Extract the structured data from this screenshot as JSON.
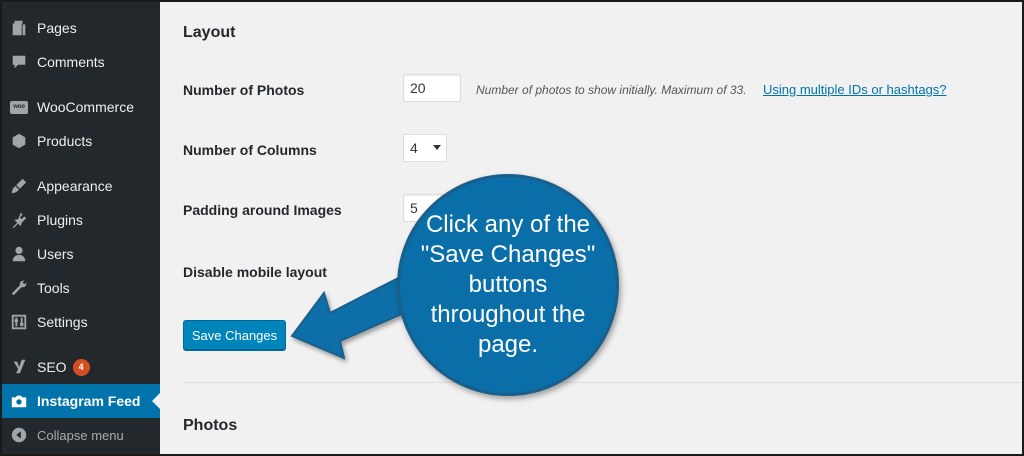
{
  "sidebar": {
    "items": [
      {
        "label": "Pages",
        "icon": "pages-icon"
      },
      {
        "label": "Comments",
        "icon": "comments-icon"
      },
      {
        "label": "WooCommerce",
        "icon": "woocommerce-icon",
        "icon_text": "woo"
      },
      {
        "label": "Products",
        "icon": "products-icon"
      },
      {
        "label": "Appearance",
        "icon": "appearance-icon"
      },
      {
        "label": "Plugins",
        "icon": "plugins-icon"
      },
      {
        "label": "Users",
        "icon": "users-icon"
      },
      {
        "label": "Tools",
        "icon": "tools-icon"
      },
      {
        "label": "Settings",
        "icon": "settings-icon"
      },
      {
        "label": "SEO",
        "icon": "seo-icon",
        "badge": "4"
      },
      {
        "label": "Instagram Feed",
        "icon": "camera-icon",
        "active": true
      },
      {
        "label": "Collapse menu",
        "icon": "collapse-icon"
      }
    ]
  },
  "main": {
    "layout_heading": "Layout",
    "fields": {
      "photos": {
        "label": "Number of Photos",
        "value": "20",
        "description": "Number of photos to show initially. Maximum of 33.",
        "link": "Using multiple IDs or hashtags?"
      },
      "columns": {
        "label": "Number of Columns",
        "value": "4"
      },
      "padding": {
        "label": "Padding around Images",
        "value": "5"
      },
      "mobile": {
        "label": "Disable mobile layout"
      }
    },
    "save_button": "Save Changes",
    "photos_heading": "Photos"
  },
  "callout": {
    "text": "Click any of the \"Save Changes\" buttons throughout the page.",
    "color": "#0a6ea8"
  },
  "colors": {
    "sidebar_bg": "#23282d",
    "active": "#0073aa",
    "content_bg": "#f1f1f1",
    "badge": "#d54e21"
  }
}
